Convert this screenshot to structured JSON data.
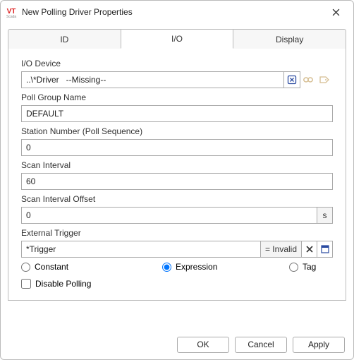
{
  "window": {
    "title": "New Polling Driver Properties",
    "logo_text": "VT",
    "logo_sub": "Scada"
  },
  "tabs": {
    "id": "ID",
    "io": "I/O",
    "display": "Display",
    "active": "io"
  },
  "fields": {
    "io_device": {
      "label": "I/O Device",
      "value": "..\\*Driver   --Missing--"
    },
    "poll_group": {
      "label": "Poll Group Name",
      "value": "DEFAULT"
    },
    "station": {
      "label": "Station Number (Poll Sequence)",
      "value": "0"
    },
    "scan_interval": {
      "label": "Scan Interval",
      "value": "60"
    },
    "scan_offset": {
      "label": "Scan Interval Offset",
      "value": "0",
      "unit": "s"
    },
    "ext_trigger": {
      "label": "External Trigger",
      "value": "*Trigger",
      "status": "= Invalid"
    }
  },
  "radios": {
    "constant": "Constant",
    "expression": "Expression",
    "tag": "Tag",
    "selected": "expression"
  },
  "checkbox": {
    "disable_polling": "Disable Polling"
  },
  "buttons": {
    "ok": "OK",
    "cancel": "Cancel",
    "apply": "Apply"
  },
  "icons": {
    "close": "close-icon",
    "clear": "clear-tag-icon",
    "link": "link-icon",
    "browse": "browse-tag-icon",
    "clear_x": "clear-icon",
    "calendar": "popup-icon"
  }
}
